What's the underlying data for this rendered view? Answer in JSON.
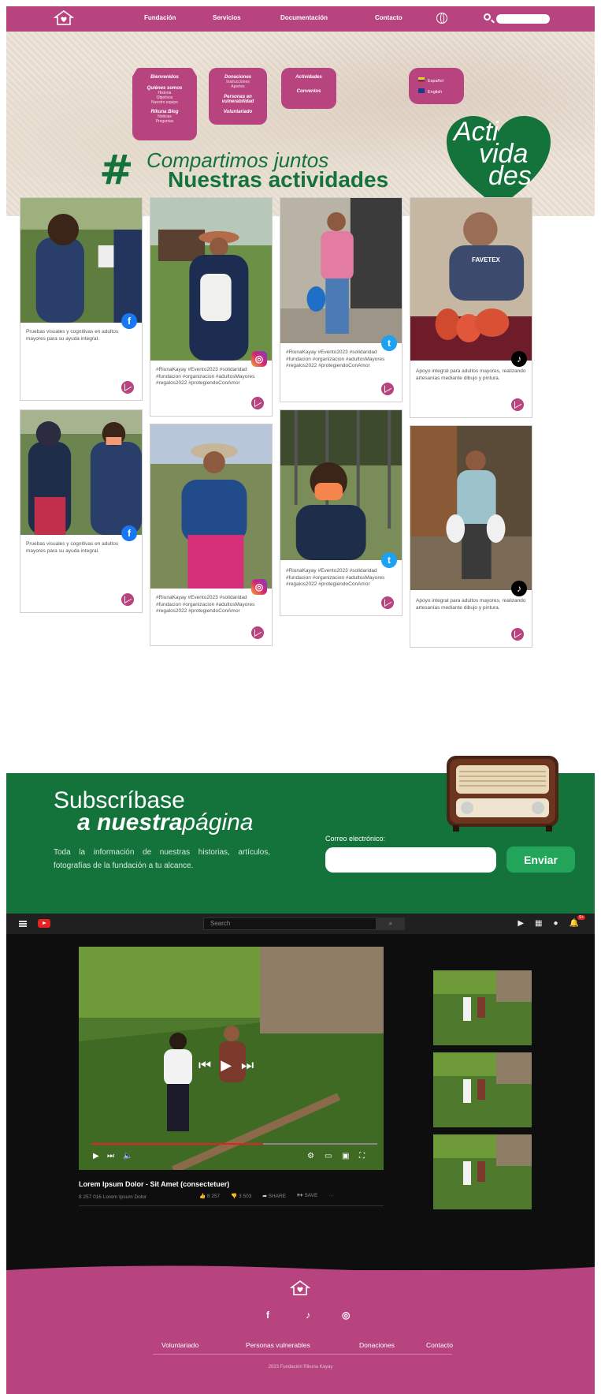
{
  "nav": {
    "links": [
      "Fundación",
      "Servicios",
      "Documentación",
      "Contacto"
    ],
    "search_placeholder": ""
  },
  "dropdowns": {
    "fundacion": {
      "items": [
        "Bienvenidos",
        "Quiénes somos",
        "Historia",
        "Objetivos",
        "Nuestro equipo",
        "Rikuna Blog",
        "Noticias",
        "Preguntas"
      ]
    },
    "servicios": {
      "items": [
        "Donaciones",
        "Instrucciones",
        "Aportes",
        "Personas en vulnerabilidad",
        "Voluntariado"
      ]
    },
    "documentacion": {
      "items": [
        "Actividades",
        "Convenios"
      ]
    },
    "idioma": {
      "items": [
        "Español",
        "English"
      ]
    }
  },
  "hero": {
    "line1": "Compartimos juntos",
    "line2": "Nuestras actividades",
    "heart_words": [
      "Acti",
      "vida",
      "des"
    ]
  },
  "gallery": {
    "cards": [
      {
        "caption": "Pruebas visuales y cognitivas en adultos mayores para su ayuda integral.",
        "network": "facebook"
      },
      {
        "caption": "#RiunaKayay #Evento2023 #solidaridad #fundacion #organizacion #adultosMayores #regalos2022 #protegiendoConAmor",
        "network": "instagram"
      },
      {
        "caption": "#RiunaKayay #Evento2023 #solidaridad #fundacion #organizacion #adultosMayores #regalos2022 #protegiendoConAmor",
        "network": "twitter"
      },
      {
        "caption": "Apoyo integral para adultos mayores, realizando artesanías mediante dibujo y pintura.",
        "network": "tiktok"
      },
      {
        "caption": "Pruebas visuales y cognitivas en adultos mayores para su ayuda integral.",
        "network": "facebook"
      },
      {
        "caption": "#RiunaKayay #Evento2023 #solidaridad #fundacion #organizacion #adultosMayores #regalos2022 #protegiendoConAmor",
        "network": "instagram"
      },
      {
        "caption": "#RiunaKayay #Evento2023 #solidaridad #fundacion #organizacion #adultosMayores #regalos2022 #protegiendoConAmor",
        "network": "twitter"
      },
      {
        "caption": "Apoyo integral para adultos mayores, realizando artesanías mediante dibujo y pintura.",
        "network": "tiktok"
      }
    ],
    "shirt_text": "FAVETEX"
  },
  "subscribe": {
    "title_line1": "Subscríbase",
    "title_a": "a",
    "title_bold": "nuestra",
    "title_light": "página",
    "description": "Toda la información de nuestras historias, artículos, fotografías de la fundación a tu alcance.",
    "email_label": "Correo electrónico:",
    "email_value": "",
    "send_label": "Enviar"
  },
  "video": {
    "search_placeholder": "Search",
    "title": "Lorem Ipsum Dolor - Sit Amet (consectetuer)",
    "meta": "8 257 016 Lorem Ipsum Dolor",
    "likes": "8 257",
    "dislikes": "3 503",
    "share_label": "SHARE",
    "save_label": "SAVE",
    "more_label": "···"
  },
  "footer": {
    "links": [
      "Voluntariado",
      "Personas vulnerables",
      "Donaciones",
      "Contacto"
    ],
    "copyright": "2023 Fundación Rikuna Kayay"
  },
  "colors": {
    "brand_pink": "#b7437f",
    "brand_green": "#13733b",
    "send_green": "#22a55a",
    "yt_red": "#e52222"
  }
}
